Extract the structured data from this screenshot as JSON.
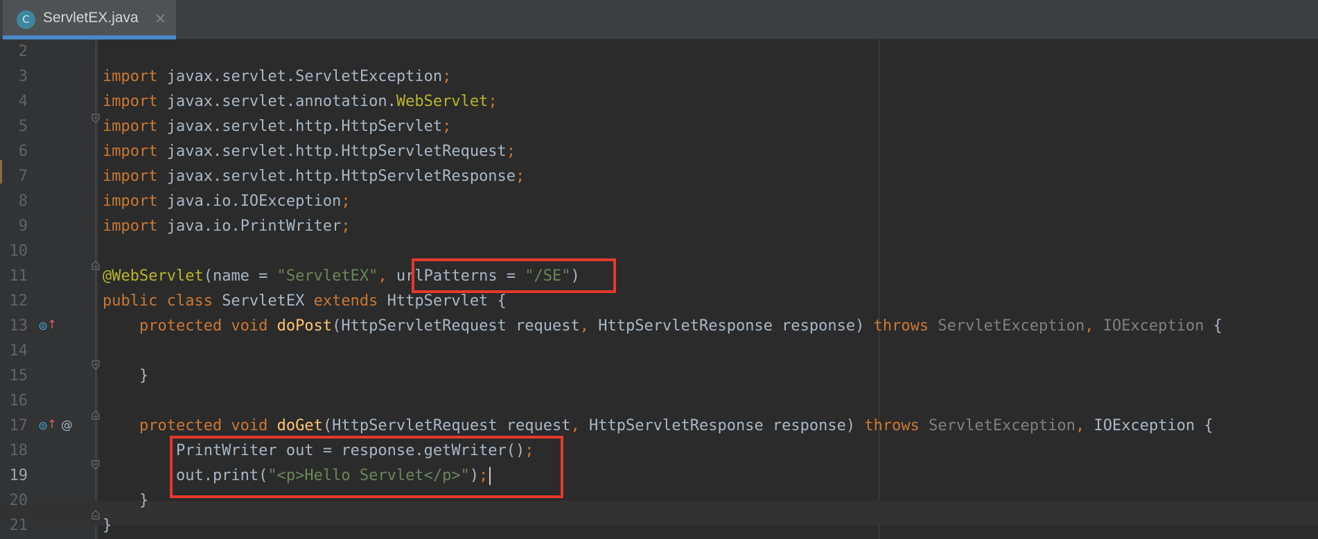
{
  "tab": {
    "icon_letter": "C",
    "filename": "ServletEX.java",
    "close": "×"
  },
  "gutter_icons": {
    "override": "⊚",
    "up_arrow": "↑",
    "at": "@"
  },
  "colors": {
    "keyword": "#cc7832",
    "string": "#6a8759",
    "annotation": "#bbb529",
    "method": "#ffc66d",
    "highlight_box": "#e5392a"
  },
  "lines": [
    {
      "num": "2",
      "tokens": []
    },
    {
      "num": "3",
      "tokens": [
        {
          "t": "import",
          "c": "k"
        },
        {
          "t": " javax.servlet.ServletException"
        },
        {
          "t": ";",
          "c": "k"
        }
      ]
    },
    {
      "num": "4",
      "tokens": [
        {
          "t": "import",
          "c": "k"
        },
        {
          "t": " javax.servlet.annotation."
        },
        {
          "t": "WebServlet",
          "c": "a"
        },
        {
          "t": ";",
          "c": "k"
        }
      ]
    },
    {
      "num": "5",
      "tokens": [
        {
          "t": "import",
          "c": "k"
        },
        {
          "t": " javax.servlet.http.HttpServlet"
        },
        {
          "t": ";",
          "c": "k"
        }
      ]
    },
    {
      "num": "6",
      "tokens": [
        {
          "t": "import",
          "c": "k"
        },
        {
          "t": " javax.servlet.http.HttpServletRequest"
        },
        {
          "t": ";",
          "c": "k"
        }
      ]
    },
    {
      "num": "7",
      "tokens": [
        {
          "t": "import",
          "c": "k"
        },
        {
          "t": " javax.servlet.http.HttpServletResponse"
        },
        {
          "t": ";",
          "c": "k"
        }
      ]
    },
    {
      "num": "8",
      "tokens": [
        {
          "t": "import",
          "c": "k"
        },
        {
          "t": " java.io.IOException"
        },
        {
          "t": ";",
          "c": "k"
        }
      ]
    },
    {
      "num": "9",
      "tokens": [
        {
          "t": "import",
          "c": "k"
        },
        {
          "t": " java.io.PrintWriter"
        },
        {
          "t": ";",
          "c": "k"
        }
      ]
    },
    {
      "num": "10",
      "tokens": []
    },
    {
      "num": "11",
      "tokens": [
        {
          "t": "@WebServlet",
          "c": "a"
        },
        {
          "t": "(name = "
        },
        {
          "t": "\"ServletEX\"",
          "c": "s"
        },
        {
          "t": ", ",
          "c": "k"
        },
        {
          "t": "urlPatterns = "
        },
        {
          "t": "\"/SE\"",
          "c": "s"
        },
        {
          "t": ")"
        }
      ]
    },
    {
      "num": "12",
      "tokens": [
        {
          "t": "public class ",
          "c": "k"
        },
        {
          "t": "ServletEX "
        },
        {
          "t": "extends ",
          "c": "k"
        },
        {
          "t": "HttpServlet {"
        }
      ]
    },
    {
      "num": "13",
      "tokens": [
        {
          "t": "    "
        },
        {
          "t": "protected void ",
          "c": "k"
        },
        {
          "t": "doPost",
          "c": "f"
        },
        {
          "t": "(HttpServletRequest request"
        },
        {
          "t": ", ",
          "c": "k"
        },
        {
          "t": "HttpServletResponse response) "
        },
        {
          "t": "throws ",
          "c": "k"
        },
        {
          "t": "ServletException",
          "c": "g"
        },
        {
          "t": ", ",
          "c": "k"
        },
        {
          "t": "IOException",
          "c": "g"
        },
        {
          "t": " {"
        }
      ]
    },
    {
      "num": "14",
      "tokens": []
    },
    {
      "num": "15",
      "tokens": [
        {
          "t": "    }"
        }
      ]
    },
    {
      "num": "16",
      "tokens": []
    },
    {
      "num": "17",
      "tokens": [
        {
          "t": "    "
        },
        {
          "t": "protected void ",
          "c": "k"
        },
        {
          "t": "doGet",
          "c": "f"
        },
        {
          "t": "(HttpServletRequest request"
        },
        {
          "t": ", ",
          "c": "k"
        },
        {
          "t": "HttpServletResponse response) "
        },
        {
          "t": "throws ",
          "c": "k"
        },
        {
          "t": "ServletException",
          "c": "g"
        },
        {
          "t": ", ",
          "c": "k"
        },
        {
          "t": "IOException {"
        }
      ]
    },
    {
      "num": "18",
      "tokens": [
        {
          "t": "        PrintWriter out = response.getWriter()"
        },
        {
          "t": ";",
          "c": "k"
        }
      ]
    },
    {
      "num": "19",
      "tokens": [
        {
          "t": "        out.print("
        },
        {
          "t": "\"<p>Hello Servlet</p>\"",
          "c": "s"
        },
        {
          "t": ")"
        },
        {
          "t": ";",
          "c": "k"
        }
      ]
    },
    {
      "num": "20",
      "tokens": [
        {
          "t": "    }"
        }
      ]
    },
    {
      "num": "21",
      "tokens": [
        {
          "t": "}"
        }
      ]
    }
  ]
}
